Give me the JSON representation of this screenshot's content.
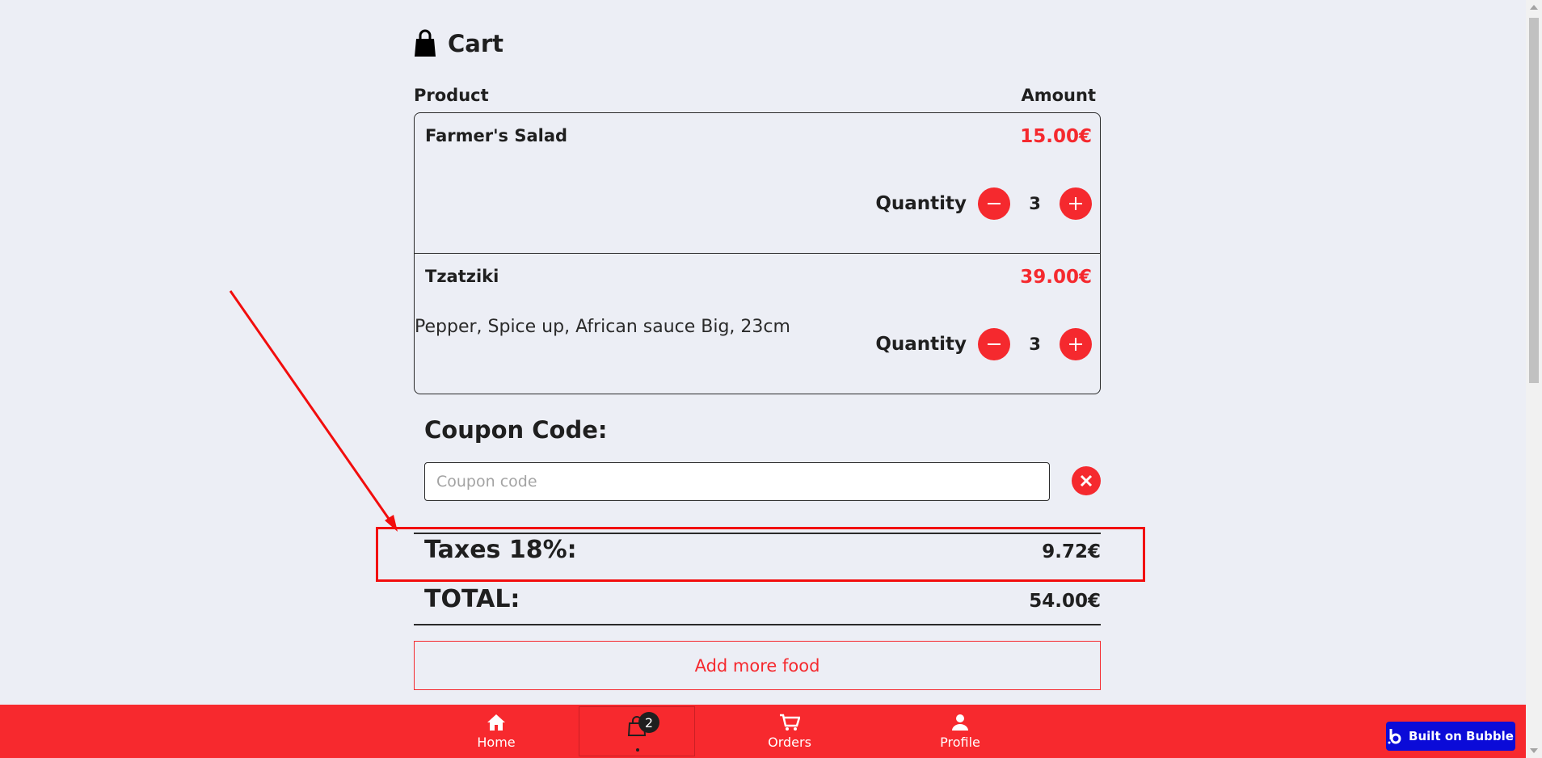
{
  "cart": {
    "title": "Cart"
  },
  "columns": {
    "product": "Product",
    "amount": "Amount"
  },
  "items": [
    {
      "name": "Farmer's Salad",
      "price": "15.00€",
      "description": "",
      "quantity_label": "Quantity",
      "quantity": "3"
    },
    {
      "name": "Tzatziki",
      "price": "39.00€",
      "description": "Pepper, Spice up, African sauce Big, 23cm",
      "quantity_label": "Quantity",
      "quantity": "3"
    }
  ],
  "coupon": {
    "title": "Coupon Code:",
    "placeholder": "Coupon code",
    "value": ""
  },
  "summary": {
    "taxes_label": "Taxes 18%:",
    "taxes_value": "9.72€",
    "total_label": "TOTAL:",
    "total_value": "54.00€"
  },
  "add_more_label": "Add more food",
  "nav": {
    "home": "Home",
    "cart_badge": "2",
    "orders": "Orders",
    "profile": "Profile"
  },
  "built_on": "Built on Bubble",
  "colors": {
    "accent": "#f5292e",
    "nav_bg": "#f7292e",
    "page_bg": "#eceef5",
    "annotation": "#f20d0d",
    "bubble": "#0b0bd8"
  }
}
